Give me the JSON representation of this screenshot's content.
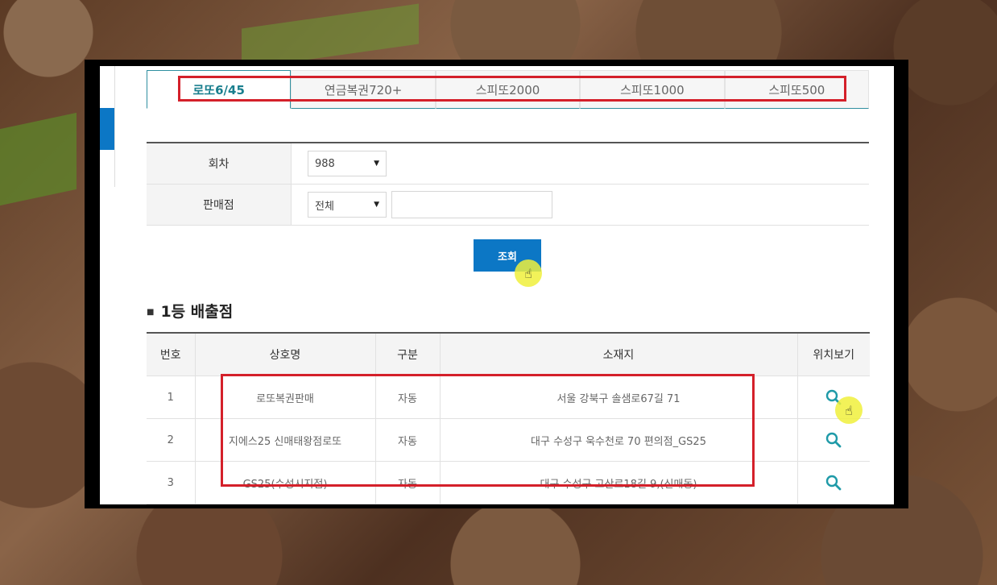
{
  "tabs": [
    {
      "label": "로또6/45",
      "active": true
    },
    {
      "label": "연금복권720+",
      "active": false
    },
    {
      "label": "스피또2000",
      "active": false
    },
    {
      "label": "스피또1000",
      "active": false
    },
    {
      "label": "스피또500",
      "active": false
    }
  ],
  "form": {
    "round_label": "회차",
    "round_value": "988",
    "store_label": "판매점",
    "store_value": "전체",
    "store_search_placeholder": ""
  },
  "search_button": "조회",
  "section_title": "1등 배출점",
  "table": {
    "headers": [
      "번호",
      "상호명",
      "구분",
      "소재지",
      "위치보기"
    ],
    "rows": [
      {
        "no": "1",
        "name": "로또복권판매",
        "type": "자동",
        "address": "서울 강북구 솔샘로67길 71"
      },
      {
        "no": "2",
        "name": "지에스25 신매태왕점로또",
        "type": "자동",
        "address": "대구 수성구 욱수천로 70 편의점_GS25"
      },
      {
        "no": "3",
        "name": "GS25(수성시지점)",
        "type": "자동",
        "address": "대구 수성구 고산로18길 9,(신매동)"
      }
    ]
  },
  "colors": {
    "accent": "#0c77c5",
    "tab_active": "#1a7f8e",
    "highlight": "#d4202a",
    "cursor": "#f0f03c"
  },
  "icons": {
    "location": "magnifier-icon",
    "cursor": "hand-pointer-icon"
  }
}
